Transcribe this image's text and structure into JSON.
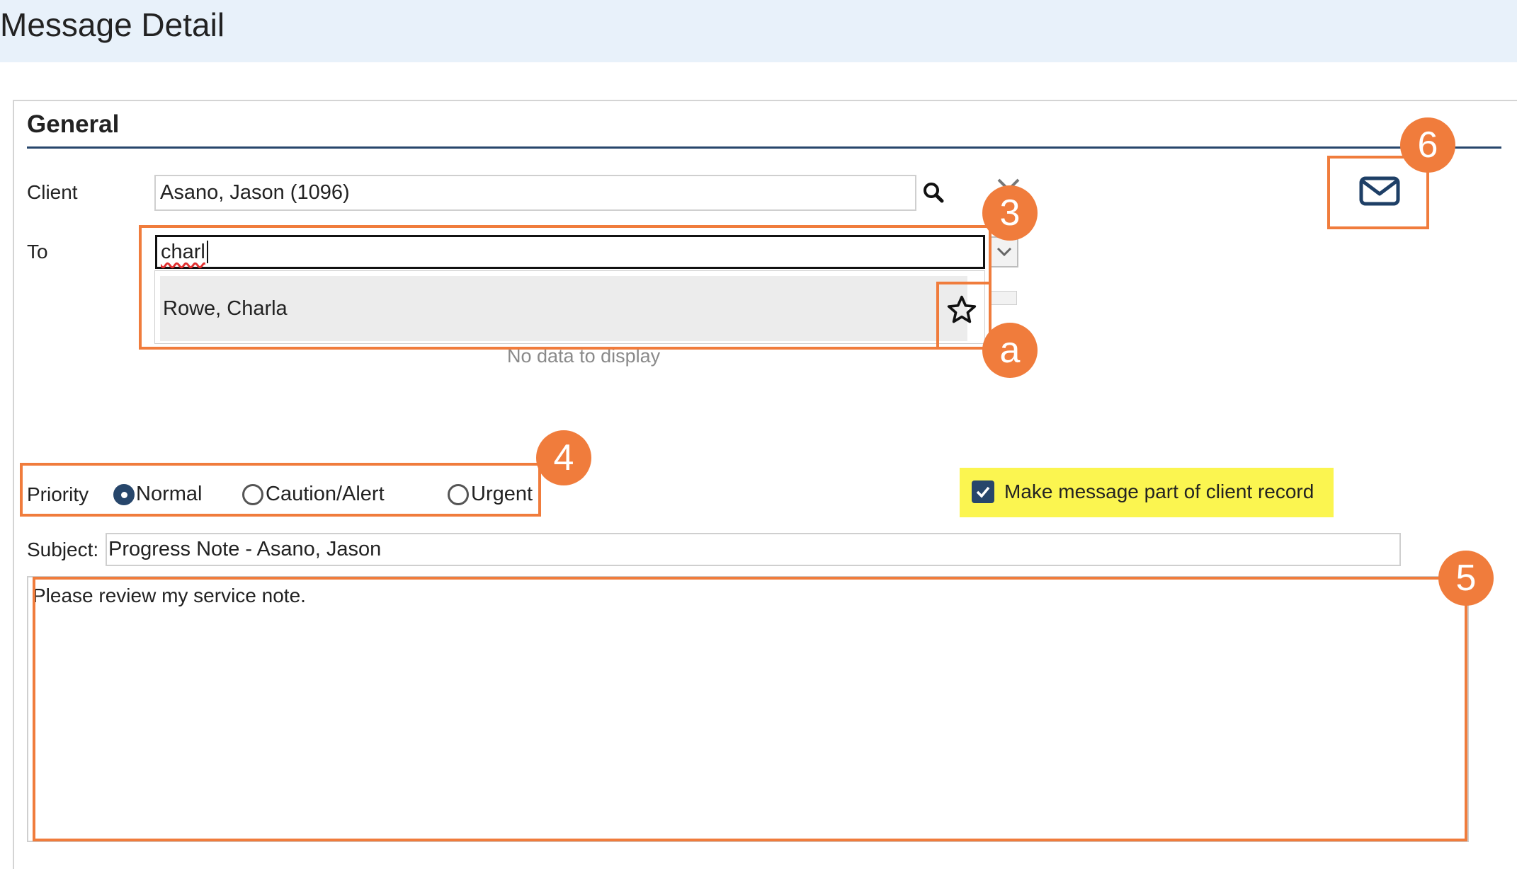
{
  "header": {
    "title": "Message Detail"
  },
  "general": {
    "section_title": "General",
    "client": {
      "label": "Client",
      "value": "Asano, Jason (1096)"
    },
    "to": {
      "label": "To",
      "value": "charl",
      "suggestion": "Rowe, Charla",
      "no_data": "No data to display"
    },
    "priority": {
      "label": "Priority",
      "options": [
        "Normal",
        "Caution/Alert",
        "Urgent"
      ],
      "selected": "Normal"
    },
    "client_record": {
      "label": "Make message part of client record",
      "checked": true
    },
    "subject": {
      "label": "Subject:",
      "value": "Progress Note - Asano, Jason"
    },
    "body": {
      "value": "Please review my service note."
    }
  },
  "annotations": {
    "callout_to": "3",
    "callout_favorite": "a",
    "callout_priority": "4",
    "callout_body": "5",
    "callout_send": "6"
  },
  "colors": {
    "header_bg": "#e8f1fa",
    "accent": "#27466b",
    "callout": "#f07c3c",
    "highlight": "#fbf550"
  }
}
